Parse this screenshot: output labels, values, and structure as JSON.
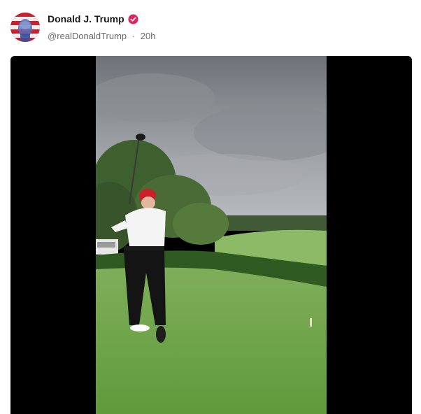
{
  "post": {
    "author": {
      "display_name": "Donald J. Trump",
      "handle": "@realDonaldTrump",
      "verified": true,
      "avatar_icon": "flag-portrait-avatar"
    },
    "timestamp_separator": "·",
    "timestamp": "20h",
    "media": {
      "type": "video",
      "icon": "golf-video-thumbnail"
    },
    "colors": {
      "verified_badge": "#e0245e",
      "name_text": "#1a1a1a",
      "meta_text": "#6b6b6b",
      "media_background": "#000000"
    }
  }
}
